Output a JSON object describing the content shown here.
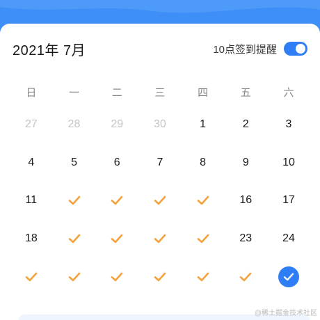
{
  "header": {
    "month_title": "2021年 7月",
    "reminder_label": "10点签到提醒",
    "reminder_on": true
  },
  "weekdays": [
    "日",
    "一",
    "二",
    "三",
    "四",
    "五",
    "六"
  ],
  "weeks": [
    [
      {
        "t": "27",
        "s": "other"
      },
      {
        "t": "28",
        "s": "other"
      },
      {
        "t": "29",
        "s": "other"
      },
      {
        "t": "30",
        "s": "other"
      },
      {
        "t": "1",
        "s": "normal"
      },
      {
        "t": "2",
        "s": "normal"
      },
      {
        "t": "3",
        "s": "normal"
      }
    ],
    [
      {
        "t": "4",
        "s": "normal"
      },
      {
        "t": "5",
        "s": "normal"
      },
      {
        "t": "6",
        "s": "normal"
      },
      {
        "t": "7",
        "s": "normal"
      },
      {
        "t": "8",
        "s": "normal"
      },
      {
        "t": "9",
        "s": "normal"
      },
      {
        "t": "10",
        "s": "normal"
      }
    ],
    [
      {
        "t": "11",
        "s": "normal"
      },
      {
        "t": "",
        "s": "checked"
      },
      {
        "t": "",
        "s": "checked"
      },
      {
        "t": "",
        "s": "checked"
      },
      {
        "t": "",
        "s": "checked"
      },
      {
        "t": "16",
        "s": "normal"
      },
      {
        "t": "17",
        "s": "normal"
      }
    ],
    [
      {
        "t": "18",
        "s": "normal"
      },
      {
        "t": "",
        "s": "checked"
      },
      {
        "t": "",
        "s": "checked"
      },
      {
        "t": "",
        "s": "checked"
      },
      {
        "t": "",
        "s": "checked"
      },
      {
        "t": "23",
        "s": "normal"
      },
      {
        "t": "24",
        "s": "normal"
      }
    ],
    [
      {
        "t": "",
        "s": "checked"
      },
      {
        "t": "",
        "s": "checked"
      },
      {
        "t": "",
        "s": "checked"
      },
      {
        "t": "",
        "s": "checked"
      },
      {
        "t": "",
        "s": "checked"
      },
      {
        "t": "",
        "s": "checked"
      },
      {
        "t": "",
        "s": "today"
      }
    ]
  ],
  "colors": {
    "accent": "#2f7ef5",
    "check": "#f5a23c",
    "other_month": "#c4c4c4"
  },
  "watermark": "@稀土掘金技术社区"
}
